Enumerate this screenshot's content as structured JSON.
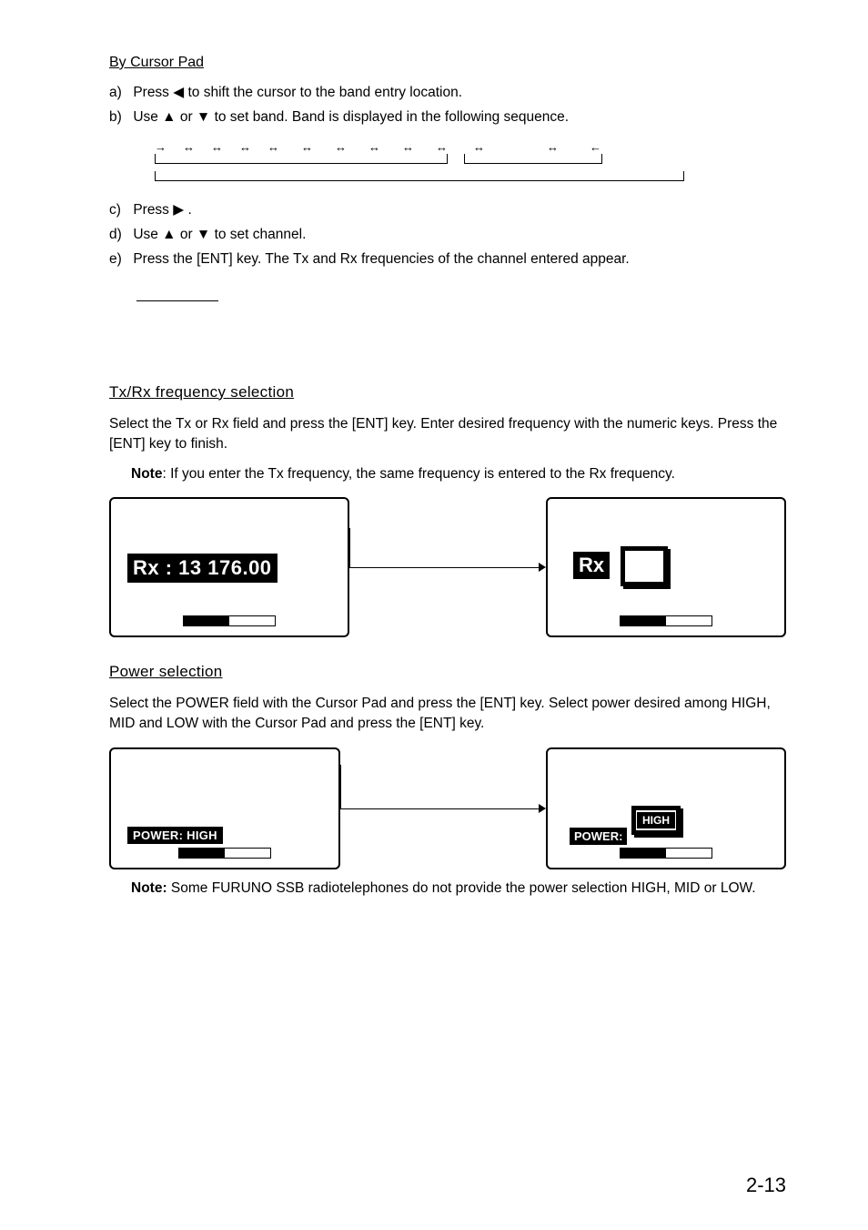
{
  "headings": {
    "by_cursor_pad": "By Cursor Pad",
    "txrx": "Tx/Rx frequency selection",
    "power": "Power selection"
  },
  "steps_a": {
    "a": "Press  ◀  to shift the cursor to the band entry location.",
    "b": "Use  ▲  or  ▼  to set band. Band is displayed in the following sequence.",
    "c": "Press ▶ .",
    "d": "Use  ▲  or  ▼  to set channel.",
    "e": "Press the [ENT] key. The Tx and Rx frequencies of the channel entered appear."
  },
  "labels": {
    "a": "a)",
    "b": "b)",
    "c": "c)",
    "d": "d)",
    "e": "e)"
  },
  "txrx_body": "Select the Tx or Rx field and press the [ENT] key. Enter desired frequency with the numeric keys. Press the [ENT] key to finish.",
  "txrx_note_label": "Note",
  "txrx_note": ": If you enter the Tx frequency, the same frequency is entered to the Rx frequency.",
  "rx_selected_text": "Rx :  13 176.00",
  "rx_label": "Rx",
  "power_body": "Select the POWER field with the Cursor Pad and press the [ENT] key. Select power desired among HIGH, MID and LOW with the Cursor Pad and press the [ENT] key.",
  "power_selected_text": "POWER: HIGH",
  "power_label": "POWER:",
  "high_label": "HIGH",
  "power_note_label": "Note:",
  "power_note": " Some FURUNO SSB radiotelephones do not provide the power selection HIGH, MID or LOW.",
  "page_num": "2-13"
}
